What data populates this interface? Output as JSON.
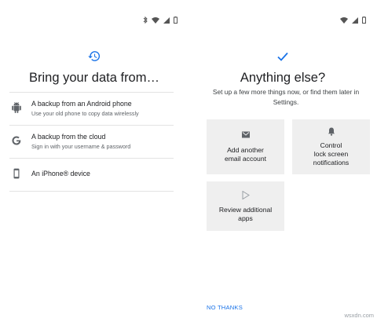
{
  "left_screen": {
    "title": "Bring your data from…",
    "options": [
      {
        "icon": "android-icon",
        "title": "A backup from an Android phone",
        "subtitle": "Use your old phone to copy data wirelessly"
      },
      {
        "icon": "google-g-icon",
        "title": "A backup from the cloud",
        "subtitle": "Sign in with your username & password"
      },
      {
        "icon": "phone-icon",
        "title": "An iPhone® device",
        "subtitle": ""
      }
    ]
  },
  "right_screen": {
    "title": "Anything else?",
    "subtitle": "Set up a few more things now, or find them later in Settings.",
    "cards": [
      {
        "icon": "email-icon",
        "label": "Add another\nemail account"
      },
      {
        "icon": "bell-icon",
        "label": "Control\nlock screen\nnotifications"
      },
      {
        "icon": "play-store-icon",
        "label": "Review additional\napps"
      }
    ],
    "no_thanks": "NO THANKS"
  },
  "watermark": "wsxdn.com",
  "colors": {
    "accent": "#1a73e8",
    "card_bg": "#efefef",
    "divider": "#e3e3e3"
  }
}
